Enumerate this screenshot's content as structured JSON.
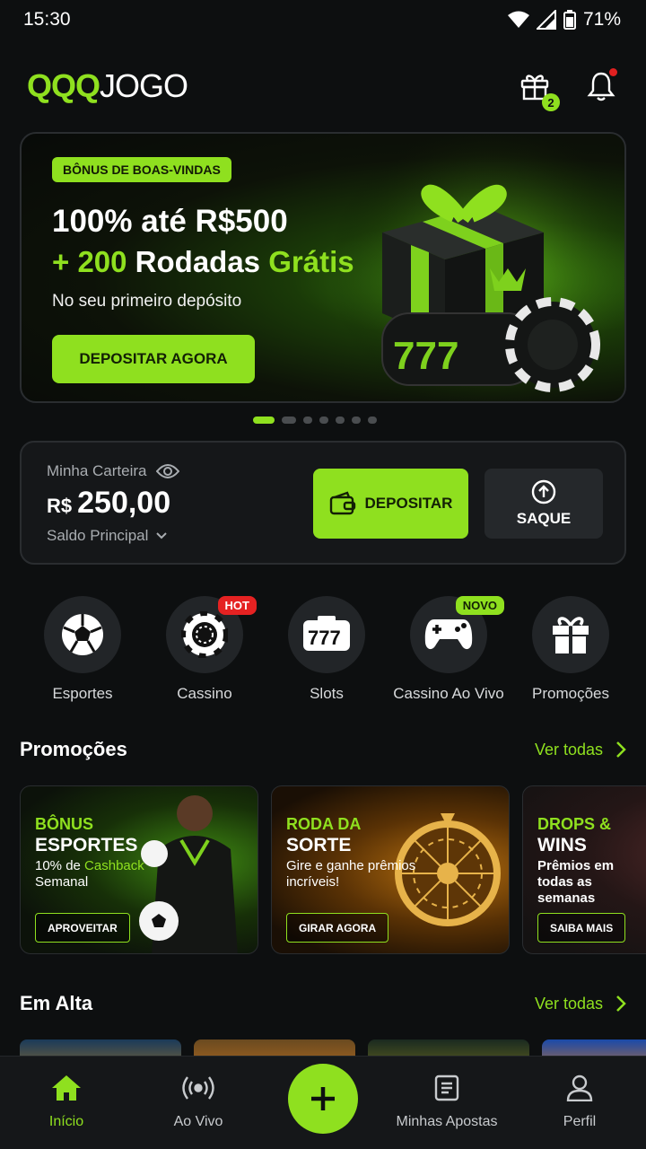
{
  "status": {
    "time": "15:30",
    "battery": "71%"
  },
  "header": {
    "logo_qqq": "QQQ",
    "logo_jogo": "JOGO",
    "gift_count": "2"
  },
  "banner": {
    "badge": "BÔNUS DE BOAS-VINDAS",
    "title": "100% até R$500",
    "title2_prefix": "+ 200",
    "title2_mid": "Rodadas",
    "title2_suffix": "Grátis",
    "subtitle": "No seu primeiro depósito",
    "cta": "DEPOSITAR AGORA",
    "slides": 7,
    "active_slide": 1
  },
  "wallet": {
    "label": "Minha Carteira",
    "currency": "R$",
    "amount": "250,00",
    "sub": "Saldo Principal",
    "deposit": "DEPOSITAR",
    "withdraw": "SAQUE"
  },
  "categories": [
    {
      "label": "Esportes",
      "icon": "soccer-ball-icon"
    },
    {
      "label": "Cassino",
      "icon": "casino-chip-icon",
      "tag": "HOT"
    },
    {
      "label": "Slots",
      "icon": "slot-machine-icon"
    },
    {
      "label": "Cassino Ao Vivo",
      "icon": "gamepad-icon",
      "tag": "NOVO"
    },
    {
      "label": "Promoções",
      "icon": "gift-icon"
    }
  ],
  "promotions": {
    "title": "Promoções",
    "see_all": "Ver todas",
    "cards": [
      {
        "t1": "BÔNUS",
        "t2": "ESPORTES",
        "desc_a": "10% de ",
        "desc_b": "Cashback",
        "desc_c": "Semanal",
        "cta": "APROVEITAR"
      },
      {
        "t1": "RODA DA",
        "t2": "SORTE",
        "desc": "Gire e ganhe prêmios incríveis!",
        "cta": "GIRAR AGORA"
      },
      {
        "t1": "DROPS &",
        "t2": "WINS",
        "desc": "Prêmios em todas as semanas",
        "cta": "SAIBA MAIS"
      }
    ]
  },
  "trending": {
    "title": "Em Alta",
    "see_all": "Ver todas"
  },
  "nav": {
    "home": "Início",
    "live": "Ao Vivo",
    "bets": "Minhas Apostas",
    "profile": "Perfil"
  },
  "colors": {
    "accent": "#8fe01f",
    "background": "#0d0f10",
    "hot": "#e52222"
  }
}
